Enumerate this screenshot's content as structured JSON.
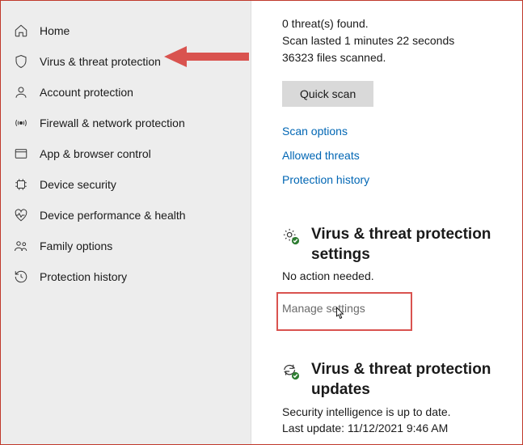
{
  "sidebar": {
    "items": [
      {
        "label": "Home"
      },
      {
        "label": "Virus & threat protection"
      },
      {
        "label": "Account protection"
      },
      {
        "label": "Firewall & network protection"
      },
      {
        "label": "App & browser control"
      },
      {
        "label": "Device security"
      },
      {
        "label": "Device performance & health"
      },
      {
        "label": "Family options"
      },
      {
        "label": "Protection history"
      }
    ]
  },
  "scan": {
    "threats": "0 threat(s) found.",
    "duration": "Scan lasted 1 minutes 22 seconds",
    "files": "36323 files scanned.",
    "quickscan_label": "Quick scan",
    "links": {
      "options": "Scan options",
      "allowed": "Allowed threats",
      "history": "Protection history"
    }
  },
  "settings_section": {
    "title": "Virus & threat protection settings",
    "sub": "No action needed.",
    "manage": "Manage settings"
  },
  "updates_section": {
    "title": "Virus & threat protection updates",
    "sub": "Security intelligence is up to date.",
    "last": "Last update: 11/12/2021 9:46 AM"
  }
}
